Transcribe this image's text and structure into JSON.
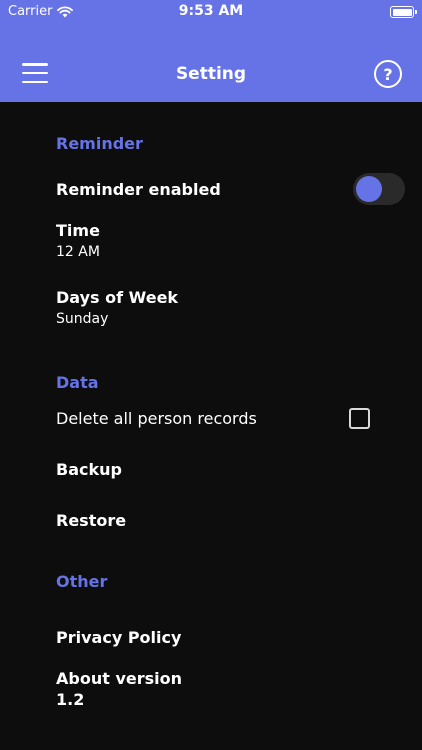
{
  "status_bar": {
    "carrier": "Carrier",
    "time": "9:53 AM"
  },
  "header": {
    "title": "Setting",
    "menu_icon": "hamburger-icon",
    "help_icon": "question-circle-icon",
    "help_glyph": "?"
  },
  "colors": {
    "accent": "#6673e6",
    "background": "#0d0d0d",
    "toggle_track": "#2a2a2a"
  },
  "reminder": {
    "section_title": "Reminder",
    "enabled_label": "Reminder enabled",
    "enabled": true,
    "time_label": "Time",
    "time_value": "12 AM",
    "days_label": "Days of Week",
    "days_value": "Sunday"
  },
  "data_section": {
    "section_title": "Data",
    "delete_label": "Delete all person records",
    "delete_checked": false,
    "backup_label": "Backup",
    "restore_label": "Restore"
  },
  "other": {
    "section_title": "Other",
    "privacy_label": "Privacy Policy",
    "about_label": "About version",
    "about_value": "1.2"
  }
}
